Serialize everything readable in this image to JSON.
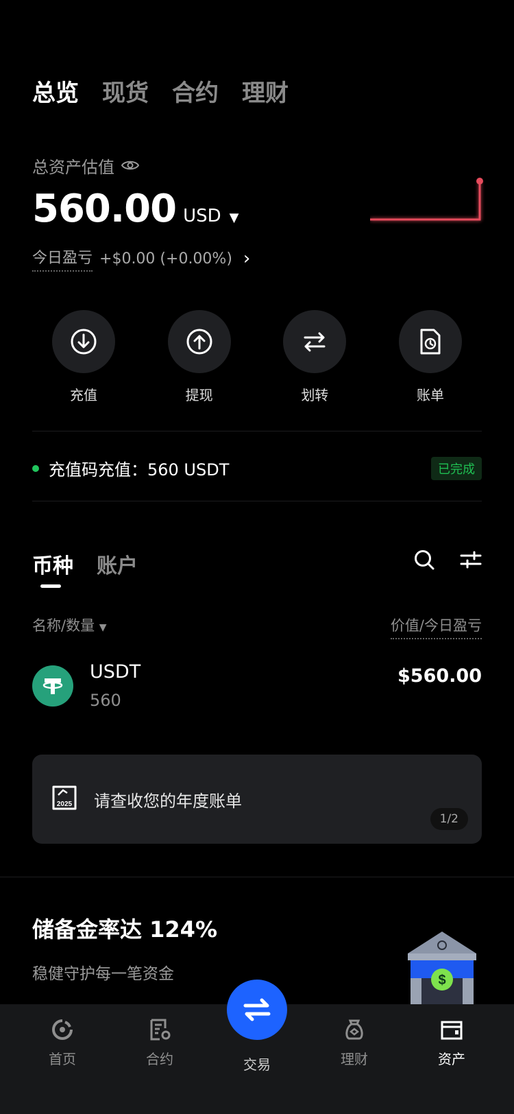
{
  "top_tabs": [
    "总览",
    "现货",
    "合约",
    "理财"
  ],
  "overview": {
    "label": "总资产估值",
    "value": "560.00",
    "currency": "USD",
    "pnl_label": "今日盈亏",
    "pnl_value": "+$0.00 (+0.00%)",
    "sparkline_color": "#e54b5c"
  },
  "actions": [
    {
      "label": "充值",
      "icon": "deposit-icon"
    },
    {
      "label": "提现",
      "icon": "withdraw-icon"
    },
    {
      "label": "划转",
      "icon": "transfer-icon"
    },
    {
      "label": "账单",
      "icon": "bill-icon"
    }
  ],
  "notice": {
    "text": "充值码充值：560 USDT",
    "status": "已完成",
    "status_color": "#1fbf52"
  },
  "coin_tabs": [
    "币种",
    "账户"
  ],
  "columns": {
    "left": "名称/数量",
    "right": "价值/今日盈亏"
  },
  "coins": [
    {
      "symbol": "USDT",
      "amount": "560",
      "value": "$560.00",
      "logo_color": "#26a17b"
    }
  ],
  "banner": {
    "text": "请查收您的年度账单",
    "year": "2025",
    "page": "1/2"
  },
  "reserve": {
    "title": "储备金率达 124%",
    "subtitle": "稳健守护每一笔资金"
  },
  "bottom_nav": [
    {
      "label": "首页",
      "icon": "home-icon"
    },
    {
      "label": "合约",
      "icon": "contract-icon"
    },
    {
      "label": "交易",
      "icon": "trade-icon"
    },
    {
      "label": "理财",
      "icon": "finance-icon"
    },
    {
      "label": "资产",
      "icon": "assets-icon"
    }
  ],
  "accent_color": "#1d63ff"
}
